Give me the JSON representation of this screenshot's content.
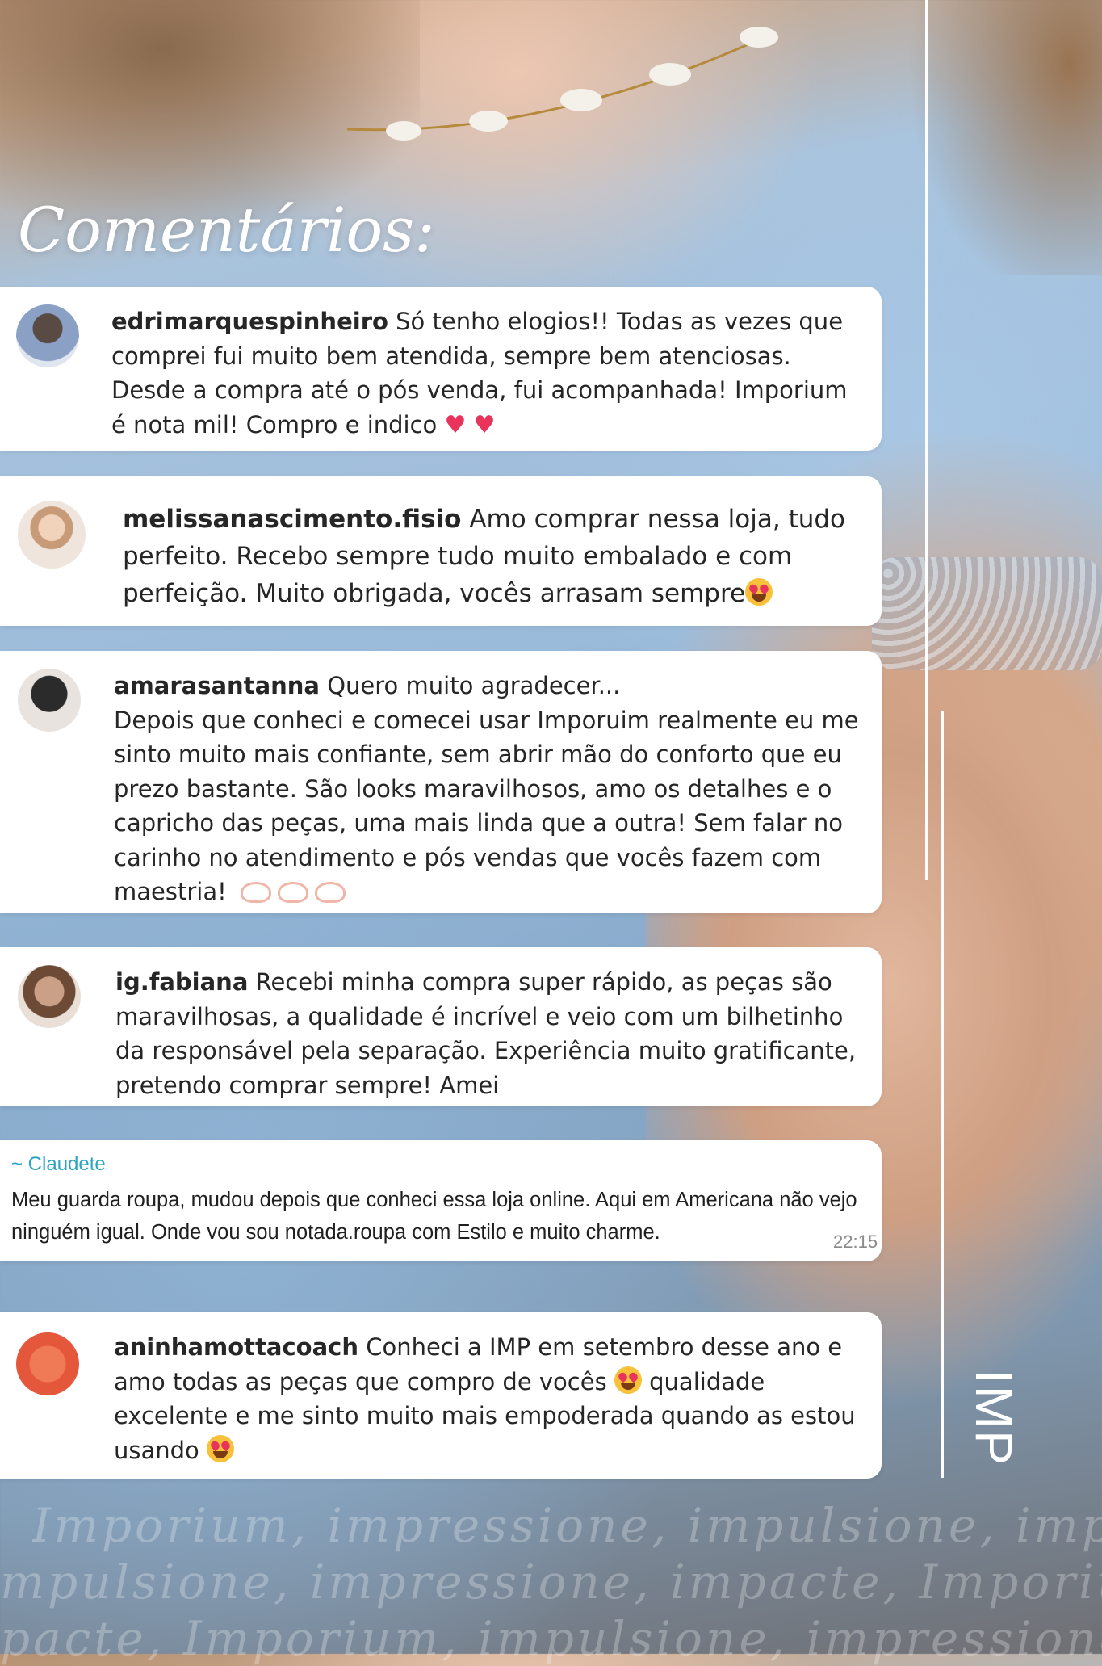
{
  "page": {
    "title": "Comentários:",
    "brand": "IMP"
  },
  "comments": [
    {
      "username": "edrimarquespinheiro",
      "text": "Só tenho elogios!! Todas as vezes que comprei fui muito bem atendida, sempre bem atenciosas. Desde a compra até o pós venda, fui acompanhada! Imporium é nota mil! Compro e indico",
      "emoji": "two-hearts"
    },
    {
      "username": "melissanascimento.fisio",
      "text": "Amo comprar nessa loja, tudo perfeito. Recebo sempre tudo muito embalado e com perfeição. Muito obrigada, vocês arrasam sempre",
      "emoji": "heart-eyes"
    },
    {
      "username": "amarasantanna",
      "text_line1": "Quero muito agradecer...",
      "text": "Depois que conheci e comecei usar Imporuim realmente eu me sinto muito mais confiante, sem abrir mão do conforto que eu prezo bastante. São looks maravilhosos, amo os detalhes e o capricho das peças, uma mais linda que a outra! Sem falar no carinho no atendimento e pós vendas que vocês fazem com maestria!",
      "emoji": "heart-hands"
    },
    {
      "username": "ig.fabiana",
      "text": "Recebi minha compra super rápido, as peças são maravilhosas, a qualidade é incrível e veio com um bilhetinho da responsável pela separação. Experiência muito gratificante, pretendo comprar sempre! Amei"
    },
    {
      "sender": "~ Claudete",
      "text": "Meu guarda roupa, mudou depois que conheci essa loja online. Aqui em Americana não vejo ninguém igual. Onde vou sou notada.roupa com Estilo e muito charme.",
      "time": "22:15"
    },
    {
      "username": "aninhamottacoach",
      "text_part1": "Conheci a IMP em setembro desse ano e amo todas as peças que compro de vocês",
      "text_part2": "qualidade excelente e me sinto muito mais empoderada quando as estou usando",
      "emoji": "heart-eyes"
    }
  ],
  "tagline_lines": [
    "Imporium, impressione, impulsione, impacte",
    "mpulsione, impressione, impacte, Imporium",
    "pacte, Imporium, impulsione, impressione, I"
  ],
  "colors": {
    "card_bg": "#ffffff",
    "text": "#262626",
    "whatsapp_name": "#2aa4c4",
    "heart": "#e8335a"
  }
}
